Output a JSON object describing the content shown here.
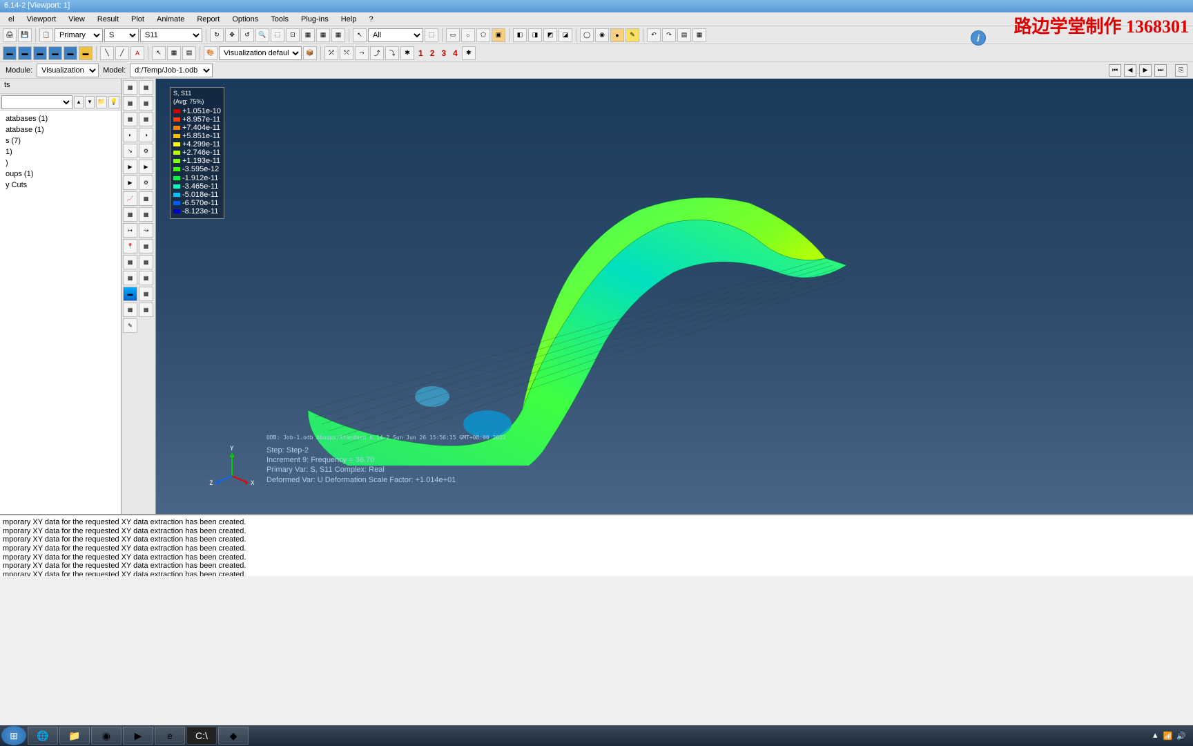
{
  "title": "6.14-2 [Viewport: 1]",
  "watermark": "路边学堂制作  1368301",
  "menu": [
    "el",
    "Viewport",
    "View",
    "Result",
    "Plot",
    "Animate",
    "Report",
    "Options",
    "Tools",
    "Plug-ins",
    "Help",
    "?"
  ],
  "toolbar1": {
    "primary_label": "Primary",
    "component_label": "S",
    "field_label": "S11",
    "all_label": "All"
  },
  "toolbar2": {
    "vis_defaults": "Visualization defaults",
    "nums": [
      "1",
      "2",
      "3",
      "4"
    ]
  },
  "module_bar": {
    "module_label": "Module:",
    "module_value": "Visualization",
    "model_label": "Model:",
    "model_value": "d:/Temp/Job-1.odb"
  },
  "tree": {
    "header": "ts",
    "items": [
      "atabases (1)",
      "atabase (1)",
      "s (7)",
      "1)",
      ")",
      "oups (1)",
      "y Cuts"
    ]
  },
  "legend": {
    "title": "S, S11",
    "avg": "(Avg: 75%)",
    "values": [
      "+1.051e-10",
      "+8.957e-11",
      "+7.404e-11",
      "+5.851e-11",
      "+4.299e-11",
      "+2.746e-11",
      "+1.193e-11",
      "-3.595e-12",
      "-1.912e-11",
      "-3.465e-11",
      "-5.018e-11",
      "-6.570e-11",
      "-8.123e-11"
    ],
    "colors": [
      "#d00000",
      "#ff4000",
      "#ff8000",
      "#ffc000",
      "#ffff00",
      "#c0ff00",
      "#80ff00",
      "#40ff00",
      "#00ff40",
      "#00ffc0",
      "#00c0ff",
      "#0060ff",
      "#0000d0"
    ]
  },
  "viewport_text": {
    "odb": "ODB: Job-1.odb   Abaqus/Standard 6.14-2   Sun Jun 26 15:56:15 GMT+08:00 2022",
    "step": "Step: Step-2",
    "increment": "Increment     9: Frequency =   36.70",
    "primary": "Primary Var: S, S11   Complex: Real",
    "deformed": "Deformed Var: U   Deformation Scale Factor: +1.014e+01",
    "triad": {
      "x": "X",
      "y": "Y",
      "z": "Z"
    }
  },
  "messages": [
    "mporary XY data for the requested XY data extraction has been created.",
    "mporary XY data for the requested XY data extraction has been created.",
    "mporary XY data for the requested XY data extraction has been created.",
    "mporary XY data for the requested XY data extraction has been created.",
    "mporary XY data for the requested XY data extraction has been created.",
    "mporary XY data for the requested XY data extraction has been created.",
    "mporary XY data for the requested XY data extraction has been created."
  ],
  "tray": {
    "time": "",
    "icons": [
      "▲",
      "📶",
      "🔊"
    ]
  }
}
